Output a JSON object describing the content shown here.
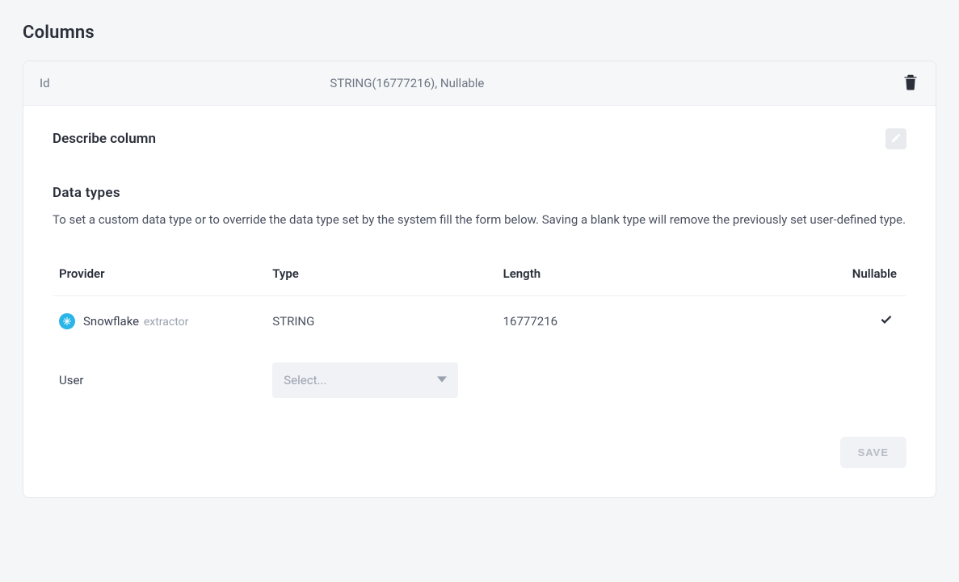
{
  "page": {
    "title": "Columns"
  },
  "column": {
    "name": "Id",
    "type_summary": "STRING(16777216), Nullable"
  },
  "describe": {
    "heading": "Describe column"
  },
  "datatypes": {
    "heading": "Data types",
    "description": "To set a custom data type or to override the data type set by the system fill the form below. Saving a blank type will remove the previously set user-defined type.",
    "headers": {
      "provider": "Provider",
      "type": "Type",
      "length": "Length",
      "nullable": "Nullable"
    },
    "rows": [
      {
        "provider_name": "Snowflake",
        "provider_sub": "extractor",
        "type": "STRING",
        "length": "16777216",
        "nullable": true
      },
      {
        "provider_name": "User",
        "provider_sub": "",
        "select_placeholder": "Select..."
      }
    ]
  },
  "actions": {
    "save": "SAVE"
  }
}
